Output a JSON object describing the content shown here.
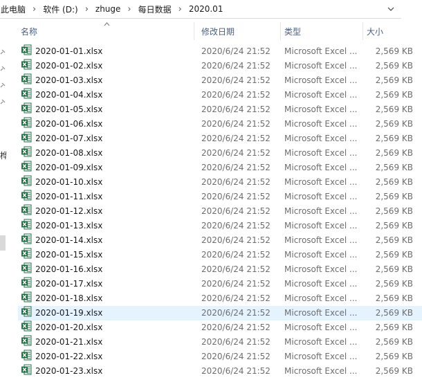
{
  "breadcrumb": [
    "此电脑",
    "软件 (D:)",
    "zhuge",
    "每日数据",
    "2020.01"
  ],
  "nav_cut_label": "桦",
  "columns": {
    "name": "名称",
    "date": "修改日期",
    "type": "类型",
    "size": "大小"
  },
  "files": [
    {
      "name": "2020-01-01.xlsx",
      "date": "2020/6/24 21:52",
      "type": "Microsoft Excel ...",
      "size": "2,569 KB"
    },
    {
      "name": "2020-01-02.xlsx",
      "date": "2020/6/24 21:52",
      "type": "Microsoft Excel ...",
      "size": "2,569 KB"
    },
    {
      "name": "2020-01-03.xlsx",
      "date": "2020/6/24 21:52",
      "type": "Microsoft Excel ...",
      "size": "2,569 KB"
    },
    {
      "name": "2020-01-04.xlsx",
      "date": "2020/6/24 21:52",
      "type": "Microsoft Excel ...",
      "size": "2,569 KB"
    },
    {
      "name": "2020-01-05.xlsx",
      "date": "2020/6/24 21:52",
      "type": "Microsoft Excel ...",
      "size": "2,569 KB"
    },
    {
      "name": "2020-01-06.xlsx",
      "date": "2020/6/24 21:52",
      "type": "Microsoft Excel ...",
      "size": "2,569 KB"
    },
    {
      "name": "2020-01-07.xlsx",
      "date": "2020/6/24 21:52",
      "type": "Microsoft Excel ...",
      "size": "2,569 KB"
    },
    {
      "name": "2020-01-08.xlsx",
      "date": "2020/6/24 21:52",
      "type": "Microsoft Excel ...",
      "size": "2,569 KB"
    },
    {
      "name": "2020-01-09.xlsx",
      "date": "2020/6/24 21:52",
      "type": "Microsoft Excel ...",
      "size": "2,569 KB"
    },
    {
      "name": "2020-01-10.xlsx",
      "date": "2020/6/24 21:52",
      "type": "Microsoft Excel ...",
      "size": "2,569 KB"
    },
    {
      "name": "2020-01-11.xlsx",
      "date": "2020/6/24 21:52",
      "type": "Microsoft Excel ...",
      "size": "2,569 KB"
    },
    {
      "name": "2020-01-12.xlsx",
      "date": "2020/6/24 21:52",
      "type": "Microsoft Excel ...",
      "size": "2,569 KB"
    },
    {
      "name": "2020-01-13.xlsx",
      "date": "2020/6/24 21:52",
      "type": "Microsoft Excel ...",
      "size": "2,569 KB"
    },
    {
      "name": "2020-01-14.xlsx",
      "date": "2020/6/24 21:52",
      "type": "Microsoft Excel ...",
      "size": "2,569 KB"
    },
    {
      "name": "2020-01-15.xlsx",
      "date": "2020/6/24 21:52",
      "type": "Microsoft Excel ...",
      "size": "2,569 KB"
    },
    {
      "name": "2020-01-16.xlsx",
      "date": "2020/6/24 21:52",
      "type": "Microsoft Excel ...",
      "size": "2,569 KB"
    },
    {
      "name": "2020-01-17.xlsx",
      "date": "2020/6/24 21:52",
      "type": "Microsoft Excel ...",
      "size": "2,569 KB"
    },
    {
      "name": "2020-01-18.xlsx",
      "date": "2020/6/24 21:52",
      "type": "Microsoft Excel ...",
      "size": "2,569 KB"
    },
    {
      "name": "2020-01-19.xlsx",
      "date": "2020/6/24 21:52",
      "type": "Microsoft Excel ...",
      "size": "2,569 KB"
    },
    {
      "name": "2020-01-20.xlsx",
      "date": "2020/6/24 21:52",
      "type": "Microsoft Excel ...",
      "size": "2,569 KB"
    },
    {
      "name": "2020-01-21.xlsx",
      "date": "2020/6/24 21:52",
      "type": "Microsoft Excel ...",
      "size": "2,569 KB"
    },
    {
      "name": "2020-01-22.xlsx",
      "date": "2020/6/24 21:52",
      "type": "Microsoft Excel ...",
      "size": "2,569 KB"
    },
    {
      "name": "2020-01-23.xlsx",
      "date": "2020/6/24 21:52",
      "type": "Microsoft Excel ...",
      "size": "2,569 KB"
    }
  ],
  "selected_index": 18,
  "icons": {
    "file": "excel-file-icon",
    "pin": "pin-icon",
    "sort": "sort-ascending-icon",
    "dropdown": "chevron-down-icon"
  },
  "colors": {
    "excel_green": "#1d7044",
    "header_text": "#4d6080",
    "selected_row": "#e5f3ff",
    "muted_text": "#6d6d6d"
  }
}
